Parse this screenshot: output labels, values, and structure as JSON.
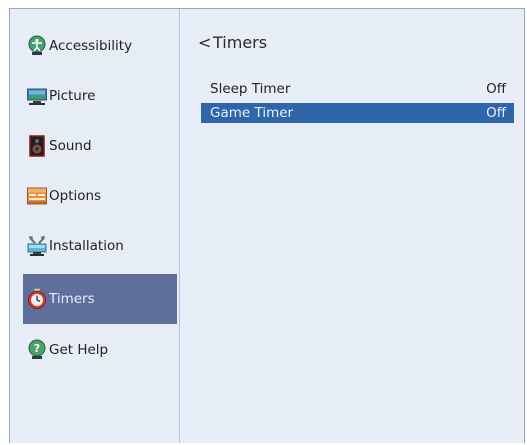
{
  "sidebar": {
    "items": [
      {
        "label": "Accessibility",
        "icon": "accessibility-icon"
      },
      {
        "label": "Picture",
        "icon": "picture-icon"
      },
      {
        "label": "Sound",
        "icon": "sound-icon"
      },
      {
        "label": "Options",
        "icon": "options-icon"
      },
      {
        "label": "Installation",
        "icon": "installation-icon"
      },
      {
        "label": "Timers",
        "icon": "timer-icon",
        "selected": true
      },
      {
        "label": "Get Help",
        "icon": "help-icon"
      }
    ]
  },
  "main": {
    "title": "Timers",
    "back_glyph": "<",
    "rows": [
      {
        "label": "Sleep Timer",
        "value": "Off"
      },
      {
        "label": "Game Timer",
        "value": "Off",
        "selected": true
      }
    ]
  },
  "colors": {
    "panel": "#e7eef7",
    "selected_sidebar": "#5d6f9a",
    "selected_row": "#2f66a9"
  }
}
